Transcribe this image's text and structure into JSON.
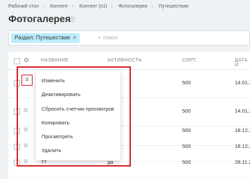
{
  "breadcrumbs": [
    "Рабочий стол",
    "Контент",
    "Контент (s1)",
    "Фотогалерея",
    "Путешествие"
  ],
  "page_title": "Фотогалерея",
  "filter": {
    "tag_label": "Раздел:  Путешествие",
    "tag_close": "×",
    "search_placeholder": "поиск"
  },
  "columns": [
    "НАЗВАНИЕ",
    "АКТИВНОСТЬ",
    "СОРТ.",
    "ДАТА И"
  ],
  "rows": [
    {
      "name": "",
      "active": "",
      "sort": "500",
      "date": "14.01.2"
    },
    {
      "name": "",
      "active": "",
      "sort": "500",
      "date": "14.01.2"
    },
    {
      "name": "",
      "active": "",
      "sort": "500",
      "date": "18.12.2"
    },
    {
      "name": "",
      "active": "",
      "sort": "500",
      "date": "18.12.2"
    },
    {
      "name": "77",
      "active": "да",
      "sort": "500",
      "date": "28.11.2"
    }
  ],
  "context_menu": [
    "Изменить",
    "Деактивировать",
    "Сбросить счетчик просмотров",
    "Копировать",
    "Просмотреть",
    "Удалить"
  ],
  "colors": {
    "highlight": "#d61f26",
    "tag_bg": "#bcedfc"
  }
}
